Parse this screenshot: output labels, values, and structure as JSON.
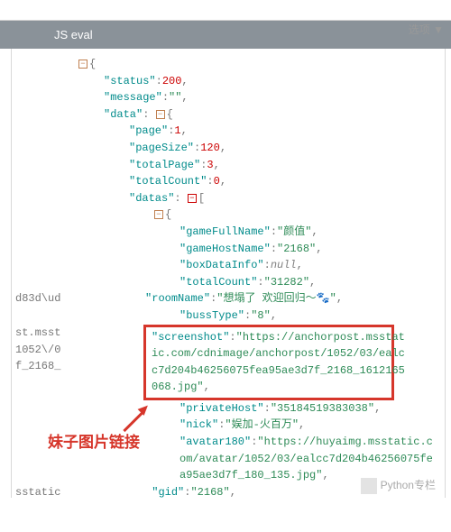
{
  "top_right": "选项 ▼",
  "header": "JS eval",
  "json_sample": {
    "status": 200,
    "message": "",
    "data": {
      "page": 1,
      "pageSize": 120,
      "totalPage": 3,
      "totalCount": 0,
      "datas_first": {
        "gameFullName": "颜值",
        "gameHostName": "2168",
        "boxDataInfo": null,
        "totalCount": "31282",
        "roomName": "想塌了 欢迎回归～🐾",
        "bussType": "8",
        "screenshot": "https://anchorpost.msstatic.com/cdnimage/anchorpost/1052/03/ealcc7d204b46256075fea95ae3d7f_2168_1612165068.jpg",
        "privateHost": "35184519383038",
        "nick": "娱加-火百万",
        "avatar180": "https://huyaimg.msstatic.com/avatar/1052/03/ealcc7d204b46256075fea95ae3d7f_180_135.jpg",
        "gid": "2168"
      }
    }
  },
  "left_fragments": {
    "f1": "d83d\\ud",
    "f2": "st.msst",
    "f3": "1052\\/0",
    "f4": "f_2168_",
    "f5": "sstatic"
  },
  "annotation": "妹子图片链接",
  "watermark": "Python专栏"
}
